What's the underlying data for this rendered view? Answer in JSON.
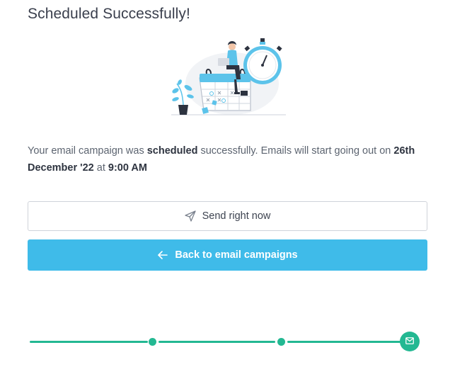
{
  "header": {
    "title": "Scheduled Successfully!"
  },
  "illustration": {
    "icon": "scheduled-campaign-illustration"
  },
  "message": {
    "prefix": "Your email campaign was ",
    "status": "scheduled",
    "middle": " successfully. Emails will start going out on ",
    "date": "26th December '22",
    "at": " at ",
    "time": "9:00 AM"
  },
  "actions": {
    "send_now_label": "Send right now",
    "send_now_icon": "paper-plane-icon",
    "back_label": "Back to email campaigns",
    "back_icon": "arrow-left-icon"
  },
  "progress": {
    "steps_total": 4,
    "final_icon": "envelope-icon"
  },
  "colors": {
    "primary": "#3fbbe9",
    "progress": "#23b892",
    "title": "#3a3f4d",
    "text": "#5c6470"
  }
}
